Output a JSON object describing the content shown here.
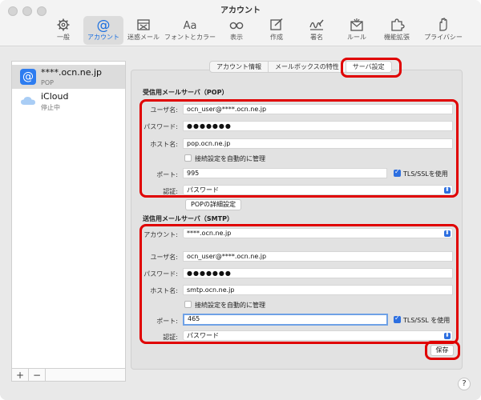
{
  "window": {
    "title": "アカウント"
  },
  "toolbar": {
    "items": [
      {
        "label": "一般",
        "icon": "gear-icon"
      },
      {
        "label": "アカウント",
        "icon": "at-sign-icon",
        "active": true
      },
      {
        "label": "迷惑メール",
        "icon": "junk-mail-icon"
      },
      {
        "label": "フォントとカラー",
        "icon": "font-icon",
        "glyph": "Aa"
      },
      {
        "label": "表示",
        "icon": "glasses-icon"
      },
      {
        "label": "作成",
        "icon": "compose-icon"
      },
      {
        "label": "署名",
        "icon": "signature-icon"
      },
      {
        "label": "ルール",
        "icon": "rules-icon"
      },
      {
        "label": "機能拡張",
        "icon": "puzzle-icon"
      },
      {
        "label": "プライバシー",
        "icon": "hand-icon"
      }
    ]
  },
  "sidebar": {
    "accounts": [
      {
        "name": "****.ocn.ne.jp",
        "sub": "POP",
        "icon": "at-sign-icon",
        "selected": true
      },
      {
        "name": "iCloud",
        "sub": "停止中",
        "icon": "cloud-icon"
      }
    ],
    "add_label": "+",
    "remove_label": "−"
  },
  "tabs": [
    {
      "label": "アカウント情報"
    },
    {
      "label": "メールボックスの特性"
    },
    {
      "label": "サーバ設定",
      "selected": true
    }
  ],
  "pop": {
    "section_title": "受信用メールサーバ（POP）",
    "username_label": "ユーザ名:",
    "username": "ocn_user@****.ocn.ne.jp",
    "password_label": "パスワード:",
    "password": "●●●●●●●",
    "host_label": "ホスト名:",
    "host": "pop.ocn.ne.jp",
    "auto_manage_label": "接続設定を自動的に管理",
    "auto_manage_checked": false,
    "port_label": "ポート:",
    "port": "995",
    "tls_label": "TLS/SSLを使用",
    "tls_checked": true,
    "auth_label": "認証:",
    "auth": "パスワード",
    "advanced_button": "POPの詳細設定"
  },
  "smtp": {
    "section_title": "送信用メールサーバ（SMTP）",
    "account_label": "アカウント:",
    "account": "****.ocn.ne.jp",
    "username_label": "ユーザ名:",
    "username": "ocn_user@****.ocn.ne.jp",
    "password_label": "パスワード:",
    "password": "●●●●●●●",
    "host_label": "ホスト名:",
    "host": "smtp.ocn.ne.jp",
    "auto_manage_label": "接続設定を自動的に管理",
    "auto_manage_checked": false,
    "port_label": "ポート:",
    "port": "465",
    "tls_label": "TLS/SSL を使用",
    "tls_checked": true,
    "auth_label": "認証:",
    "auth": "パスワード"
  },
  "save_button": "保存",
  "help_label": "?",
  "colors": {
    "accent": "#2d6fe0",
    "highlight": "#e00000"
  }
}
